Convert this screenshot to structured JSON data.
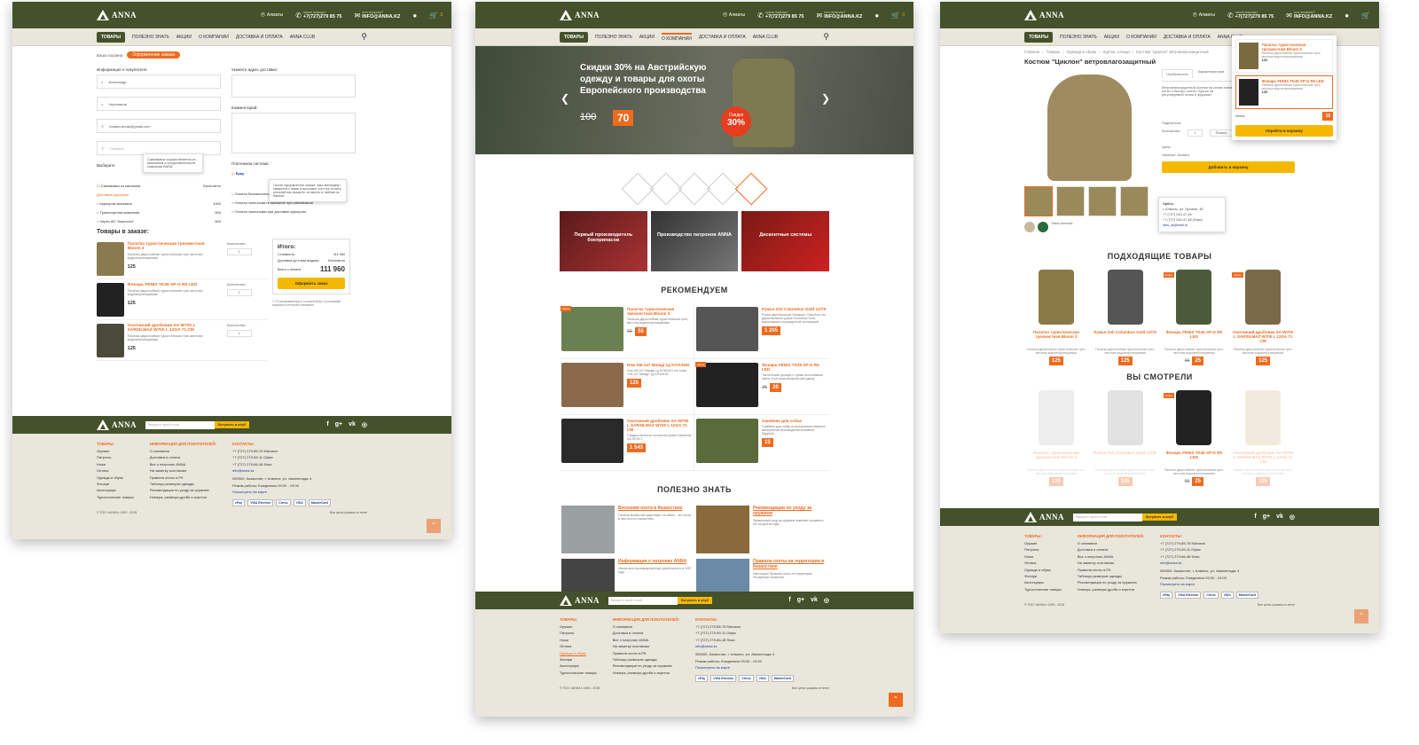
{
  "brand": "ANNA",
  "header": {
    "city": "Алматы",
    "phone_caption": "нужна помощь?",
    "phone": "+7(727)279 85 75",
    "mail_caption": "есть вопросы?",
    "email": "INFO@ANNA.KZ",
    "cart_count": "3"
  },
  "nav": {
    "items": [
      "Товары",
      "Полезно знать",
      "Акции",
      "О компании",
      "Доставка и оплата",
      "ANNA Club"
    ]
  },
  "checkout": {
    "breadcrumb": "Ваша корзина",
    "step": "Оформление заказа",
    "buyer_label": "Информация о покупателе:",
    "name": "Александр",
    "surname": "Черепанов",
    "email": "bolatov.anuar@gmail.com",
    "phone_ph": "Телефон",
    "address_label": "Укажите адрес доставки:",
    "comment_label": "Комментарий:",
    "pickup_tip": "Самовывоз осуществляется из магазинов и представительств компании ANNA",
    "delivery_label": "Выберите",
    "pickup": "Самовывоз из магазина",
    "pickup_price": "Бесплатно",
    "couriers": "Доставка курьером",
    "courier1": "Курьером магазина",
    "courier1_price": "1000",
    "courier2": "Транспортная компания",
    "courier2_price": "500",
    "courier3": "Через АО \"Казпочта\"",
    "courier3_price": "500",
    "payment_label": "Платежная система:",
    "cash": "Epay",
    "payment_tip": "После оформления заказа, ваш менеджер свяжется с вами и выставит счет на оплату, который вы сможете оплатить в любом из банков.",
    "pay1": "Оплата безналичным расчетом",
    "pay2": "Оплата наличными в магазине при самовывозе",
    "pay3": "Оплата наличными при доставке курьером",
    "order_title": "Товары в заказе:",
    "qty_label": "Количество:",
    "items": [
      {
        "name": "Палатка туристическая трехместная Bloom 3",
        "desc": "Палатка двухслойная туристическая трех-местная водонепроницаемая",
        "price": "125",
        "qty": "1"
      },
      {
        "name": "Фонарь FENIX TK45 XP-G R5 LED",
        "desc": "Палатка двухслойная туристическая трех-местная водонепроницаемая",
        "price": "125",
        "qty": "1"
      },
      {
        "name": "Охотничий дробовик SA-W700 L SARSILMAZ W700 L 12GA 71 CM",
        "desc": "Палатка двухслойная туристическая трех-местная водонепроницаемая",
        "price": "125",
        "qty": "1"
      }
    ],
    "total_title": "Итого:",
    "cost_label": "Стоимость:",
    "cost": "111 960",
    "delivery_cost_label": "Доставка до точки выдачи:",
    "delivery_cost": "Бесплатно",
    "grand_label": "Всего к оплате:",
    "grand": "111 960",
    "submit": "Оформить заказ",
    "agree": "Я ознакомлен(а) и согласен(на) с условиями покупки в интернет-магазине"
  },
  "home": {
    "banner_title": "Скидки 30% на Австрийскую одежду и товары для охоты Европейского производства",
    "old_price": "100",
    "new_price": "70",
    "badge_top": "Скидки",
    "badge_val": "30%",
    "tiles": [
      "Первый производитель боеприпасов",
      "Производство патронов ANNA",
      "Дисконтные системы"
    ],
    "recommend_title": "Рекомендуем",
    "products": [
      {
        "name": "Палатка туристическая трехместная Bloom 3",
        "desc": "Палатка двухслойная туристическая трех-местная водонепроницаемая",
        "old": "65",
        "price": "55",
        "tag": "Акция"
      },
      {
        "name": "Ружье Zoli Columbus Gold 12/75",
        "desc": "Ружье двуствольное Комфорт Columbus это двухствольное ружье Columbus Gold, выпускаемое сокращенной коллекцией",
        "old": "",
        "price": "1 205",
        "tag": ""
      },
      {
        "name": "Нож KB-147 Matagi 1g KITASHO",
        "desc": "Нож KB-147 Matagi 1g KITASHO это ножи \"KB-147 Matagi\" 1g KITASHO",
        "old": "",
        "price": "125",
        "tag": ""
      },
      {
        "name": "Фонарь FENIX TK45 XP-G R5 LED",
        "desc": "Тактический фонарь с тремя источниками света, в котором мощный светодиод",
        "old": "25",
        "price": "20",
        "tag": "Акция"
      },
      {
        "name": "Охотничий дробовик SA-W700 L SARSILMAZ W700 L 12GA 71 CM",
        "desc": "Гладкоствольное охотничье ружье Sarsilmaz SA-W700 L",
        "old": "",
        "price": "1 543",
        "tag": ""
      },
      {
        "name": "Ошейник для собак",
        "desc": "Ошейник для собак из высококачественных материалов производства компании Niggeloh",
        "old": "",
        "price": "15",
        "tag": ""
      }
    ],
    "useful_title": "Полезно знать",
    "articles": [
      {
        "name": "Весенняя охота в Казахстане",
        "desc": "Особым моментом существует на земле - это охота в частности в Казахстане."
      },
      {
        "name": "Рекомендации по уходу за оружием",
        "desc": "Правильный уход за оружием помогает сохранить его на долгие годы."
      },
      {
        "name": "Информация о патронах ANNA",
        "desc": "Начав свою производственную деятельность в 1997 году."
      },
      {
        "name": "Правила охоты на территории в Казахстане",
        "desc": "Настоящие Правила охоты на территории Республики Казахстан."
      }
    ]
  },
  "product": {
    "breadcrumb": [
      "Главная",
      "Товары",
      "Одежда и обувь",
      "Куртки, плащи",
      "Костюм \"Циклон\" ветровлагозащитный"
    ],
    "title": "Костюм \"Циклон\" ветровлагозащитный",
    "tabs": [
      "Особенности",
      "Характеристики"
    ],
    "desc": "Ветровлагозащитный костюм на сплав ткани легко и быстро сохнет. Куртка на регулируемой талии и фуражке.",
    "share": "Поделиться:",
    "qty": "Количество:",
    "size": "Размер",
    "price_label": "Цена:",
    "avail": "Наличие: Алматы",
    "add": "Добавить в корзину",
    "store_title": "Ирбис:",
    "store_addr": "г. Алматы, ул. Луговая, 48",
    "store_phone1": "+7 (727) 245-47-46",
    "store_phone2": "+7 (727) 245-47-48 (Факс)",
    "store_mail": "irbis_sk@mail.ru",
    "color_tip": "Темно-зеленый",
    "cart_pop": {
      "item1": "Палатка туристическая трехместная Bloom 3",
      "item1_desc": "Палатка двухслойная туристическая трех-местная водонепроницаемая",
      "item1_price": "125",
      "item2": "Фонарь FENIX TK45 XP-G R5 LED",
      "item2_desc": "Палатка двухслойная туристическая трех-местная водонепроницаемая",
      "item2_price": "125",
      "total_label": "Итого:",
      "total": "15",
      "go": "Перейти в корзину"
    },
    "fit_title": "Подходящие товары",
    "fit": [
      {
        "name": "Палатка туристическая трехместная Bloom 3",
        "price": "125",
        "old": "",
        "tag": ""
      },
      {
        "name": "Ружье Zoli Columbus Gold 12/75",
        "price": "125",
        "old": "",
        "tag": ""
      },
      {
        "name": "Фонарь FENIX TK45 XP-G R5 LED",
        "price": "25",
        "old": "65",
        "tag": "Акция"
      },
      {
        "name": "Охотничий дробовик SA-W700 L SARSILMAZ W700 L 12GA 71 CM",
        "price": "125",
        "old": "",
        "tag": "Акция"
      }
    ],
    "seen_title": "Вы смотрели",
    "seen": [
      {
        "name": "Палатка туристическая трехместная Bloom 3",
        "price": "125",
        "old": ""
      },
      {
        "name": "Ружье Zoli Columbus Gold 12/75",
        "price": "125",
        "old": ""
      },
      {
        "name": "Фонарь FENIX TK45 XP-G R5 LED",
        "price": "25",
        "old": "65"
      },
      {
        "name": "Охотничий дробовик SA-W700 L SARSILMAZ W700 L 12GA 71 CM",
        "price": "125",
        "old": ""
      }
    ],
    "desc_short": "Палатка двухслойная туристическая трех-местная водонепроницаемая"
  },
  "footer": {
    "email_ph": "Введите свой e-mail",
    "join": "Вступить в клуб",
    "col1_title": "Товары:",
    "col1": [
      "Оружие",
      "Патроны",
      "Ножи",
      "Оптика",
      "Одежда и обувь",
      "Фонари",
      "Аксессуары",
      "Туристические товары"
    ],
    "col2_title": "Информация для покупателей:",
    "col2": [
      "О компании",
      "Доставка и оплата",
      "Все о патронах ANNA",
      "На заметку охотникам",
      "Правила охоты в РК",
      "Таблица размеров одежды",
      "Рекомендации по уходу за оружием",
      "Номера, размеры дроби и картечи"
    ],
    "col3_title": "Контакты:",
    "phone1": "+7 (727) 279-85-75 Магазин",
    "phone2": "+7 (727) 279-59-11 Офис",
    "phone3": "+7 (727) 279-66-48 Факс",
    "email": "info@anna.kz",
    "address": "050000, Казахстан, г. Алматы, ул. Амангельды 4",
    "hours": "Режим работы: Ежедневно 09:00 - 19:00",
    "map": "Посмотреть на карте",
    "copyright": "© ТОО «АННА» 1993 - 2015",
    "prices_note": "Все цены указаны в тенге",
    "pay": [
      "ePay",
      "VISA Electron",
      "Cirrus",
      "VISA",
      "MasterCard"
    ]
  },
  "colors": {
    "olive": "#44512a",
    "orange": "#ee6a1e",
    "yellow": "#f5b800",
    "beige": "#e9e6dc"
  }
}
